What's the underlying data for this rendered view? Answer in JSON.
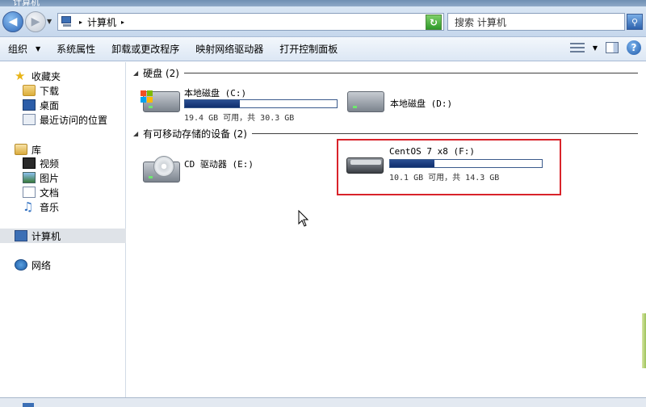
{
  "window": {
    "title": "计算机"
  },
  "address": {
    "crumb": "计算机"
  },
  "search": {
    "placeholder": "搜索 计算机"
  },
  "toolbar": {
    "organize": "组织",
    "system_properties": "系统属性",
    "uninstall": "卸载或更改程序",
    "map_drive": "映射网络驱动器",
    "control_panel": "打开控制面板"
  },
  "sidebar": {
    "favorites": "收藏夹",
    "downloads": "下载",
    "desktop": "桌面",
    "recent": "最近访问的位置",
    "libraries": "库",
    "videos": "视频",
    "pictures": "图片",
    "documents": "文档",
    "music": "音乐",
    "computer": "计算机",
    "network": "网络"
  },
  "groups": {
    "hard_disks": "硬盘 (2)",
    "removable": "有可移动存储的设备 (2)"
  },
  "drives": {
    "c": {
      "name": "本地磁盘 (C:)",
      "info": "19.4 GB 可用，共 30.3 GB",
      "used_fraction": 0.36
    },
    "d": {
      "name": "本地磁盘 (D:)"
    },
    "e": {
      "name": "CD 驱动器 (E:)"
    },
    "f": {
      "name": "CentOS 7 x8 (F:)",
      "info": "10.1 GB 可用，共 14.3 GB",
      "used_fraction": 0.29
    }
  },
  "colors": {
    "highlight": "#d9232a",
    "bar_fill": "#1a3c7c"
  }
}
